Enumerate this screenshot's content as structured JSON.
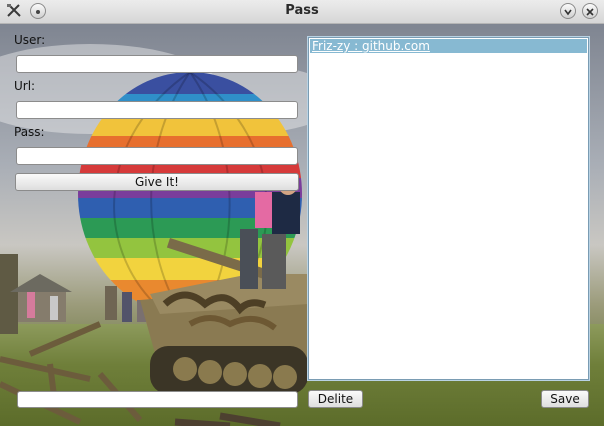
{
  "window": {
    "title": "Pass"
  },
  "form": {
    "user_label": "User:",
    "url_label": "Url:",
    "pass_label": "Pass:",
    "user_value": "",
    "url_value": "",
    "pass_value": "",
    "give_button": "Give It!"
  },
  "list": {
    "items": [
      {
        "label": "Friz-zy : github.com",
        "selected": true
      }
    ]
  },
  "bottom": {
    "input_value": "",
    "delete_button": "Delite",
    "save_button": "Save"
  },
  "icons": {
    "app": "tools-icon",
    "menu": "window-menu-icon",
    "minimize": "minimize-icon",
    "close": "close-icon"
  }
}
